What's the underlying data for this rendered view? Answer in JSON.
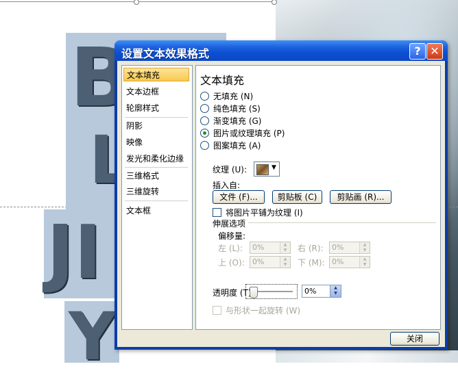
{
  "dialog": {
    "title": "设置文本效果格式",
    "help_label": "?",
    "close_icon": "✕",
    "close_button": "关闭"
  },
  "nav": {
    "items": [
      {
        "label": "文本填充",
        "selected": true
      },
      {
        "label": "文本边框"
      },
      {
        "label": "轮廓样式"
      },
      {
        "label": "阴影"
      },
      {
        "label": "映像"
      },
      {
        "label": "发光和柔化边缘"
      },
      {
        "label": "三维格式"
      },
      {
        "label": "三维旋转"
      },
      {
        "label": "文本框"
      }
    ]
  },
  "panel": {
    "title": "文本填充",
    "fill_options": [
      {
        "label": "无填充 (N)",
        "checked": false
      },
      {
        "label": "纯色填充 (S)",
        "checked": false
      },
      {
        "label": "渐变填充 (G)",
        "checked": false
      },
      {
        "label": "图片或纹理填充 (P)",
        "checked": true
      },
      {
        "label": "图案填充 (A)",
        "checked": false
      }
    ],
    "texture_label": "纹理 (U):",
    "insert_from_label": "插入自:",
    "buttons": {
      "file": "文件 (F)...",
      "clipboard": "剪贴板 (C)",
      "clipart": "剪贴画 (R)..."
    },
    "tile_checkbox": "将图片平铺为纹理 (I)",
    "stretch_options": "伸展选项",
    "offset_label": "偏移量:",
    "offsets": {
      "left": {
        "label": "左 (L):",
        "value": "0%"
      },
      "right": {
        "label": "右 (R):",
        "value": "0%"
      },
      "top": {
        "label": "上 (O):",
        "value": "0%"
      },
      "bottom": {
        "label": "下 (M):",
        "value": "0%"
      }
    },
    "transparency_label": "透明度 (T):",
    "transparency_value": "0%",
    "transparency_fraction": 0,
    "rotate_checkbox": "与形状一起旋转 (W)"
  },
  "background": {
    "letters": [
      "B",
      "L",
      "JI",
      "Y"
    ]
  }
}
